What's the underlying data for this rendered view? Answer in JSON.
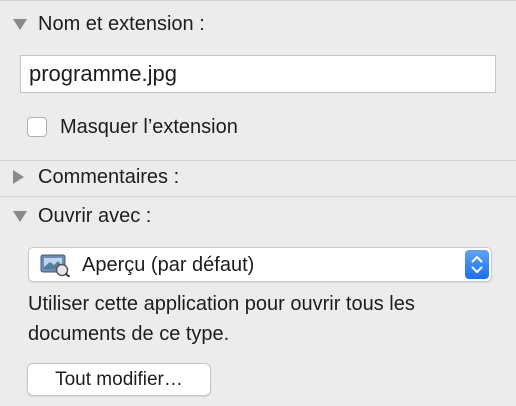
{
  "name_section": {
    "title": "Nom et extension :",
    "filename": "programme.jpg",
    "hide_extension_label": "Masquer l’extension"
  },
  "comments_section": {
    "title": "Commentaires :"
  },
  "open_with_section": {
    "title": "Ouvrir avec :",
    "selected_app": "Aperçu (par défaut)",
    "app_icon": "preview-app-icon",
    "description": "Utiliser cette application pour ouvrir tous les documents de ce type.",
    "change_all_label": "Tout modifier…"
  },
  "colors": {
    "background": "#ececec",
    "accent": "#1d6ef0"
  }
}
